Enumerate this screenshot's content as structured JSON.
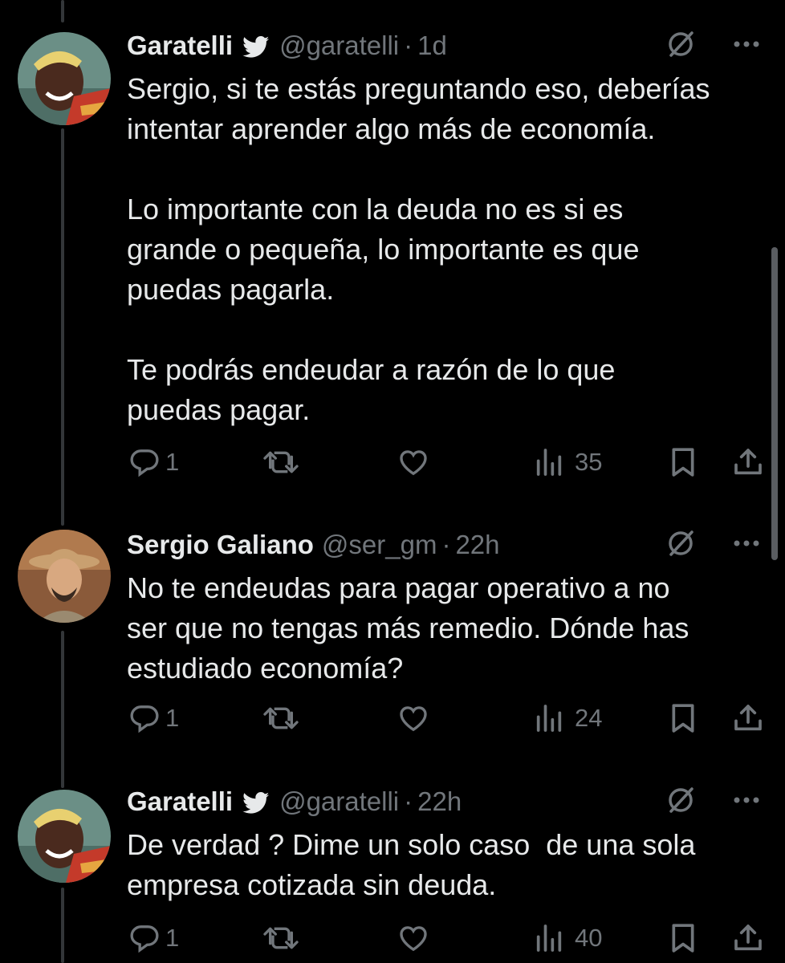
{
  "tweets": [
    {
      "name": "Garatelli",
      "verified": true,
      "handle": "@garatelli",
      "sep": "·",
      "time": "1d",
      "text": "Sergio, si te estás preguntando eso, deberías\nintentar aprender algo más de economía.\n\nLo importante con la deuda no es si es\ngrande o pequeña, lo importante es que\npuedas pagarla.\n\nTe podrás endeudar a razón de lo que\npuedas pagar.",
      "replies": "1",
      "views": "35"
    },
    {
      "name": "Sergio Galiano",
      "verified": false,
      "handle": "@ser_gm",
      "sep": "·",
      "time": "22h",
      "text": "No te endeudas para pagar operativo a no\nser que no tengas más remedio. Dónde has\nestudiado economía?",
      "replies": "1",
      "views": "24"
    },
    {
      "name": "Garatelli",
      "verified": true,
      "handle": "@garatelli",
      "sep": "·",
      "time": "22h",
      "text": "De verdad ? Dime un solo caso  de una sola\nempresa cotizada sin deuda.",
      "replies": "1",
      "views": "40"
    }
  ],
  "colors": {
    "background": "#000000",
    "text": "#e7e9ea",
    "secondary": "#71767b",
    "thread_line": "#333639"
  },
  "icons": [
    "twitter-bird-icon",
    "grok-icon",
    "more-icon",
    "reply-icon",
    "retweet-icon",
    "like-icon",
    "views-icon",
    "bookmark-icon",
    "share-icon"
  ]
}
